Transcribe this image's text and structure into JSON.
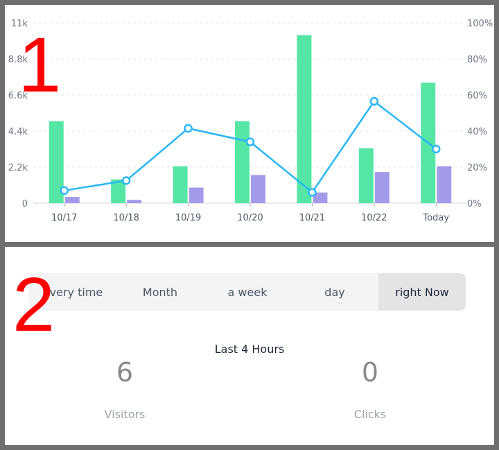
{
  "markers": {
    "one": "1",
    "two": "2"
  },
  "chart_data": {
    "type": "bar",
    "categories": [
      "10/17",
      "10/18",
      "10/19",
      "10/20",
      "10/21",
      "10/22",
      "Today"
    ],
    "left_axis": {
      "ticks": [
        "0",
        "2.2k",
        "4.4k",
        "6.6k",
        "8.8k",
        "11k"
      ],
      "ylim": [
        0,
        11000
      ]
    },
    "right_axis": {
      "ticks": [
        "0%",
        "20%",
        "40%",
        "60%",
        "80%",
        "100%"
      ],
      "ylim": [
        0,
        100
      ]
    },
    "series": [
      {
        "kind": "bar",
        "axis": "left",
        "color": "#55e6a5",
        "values": [
          5000,
          1450,
          2250,
          5000,
          10250,
          3350,
          7350
        ]
      },
      {
        "kind": "bar",
        "axis": "left",
        "color": "#a29bea",
        "values": [
          380,
          200,
          950,
          1720,
          650,
          1900,
          2250
        ]
      },
      {
        "kind": "line",
        "axis": "right",
        "color": "#29b6f6",
        "values": [
          7,
          12.5,
          41.5,
          34,
          6,
          56.5,
          30
        ]
      }
    ],
    "grid": true
  },
  "period_selector": {
    "options": [
      "every time",
      "Month",
      "a week",
      "day",
      "right Now"
    ],
    "selected": "right Now"
  },
  "summary": {
    "range_title": "Last 4 Hours",
    "visitors": {
      "value": "6",
      "label": "Visitors"
    },
    "clicks": {
      "value": "0",
      "label": "Clicks"
    }
  }
}
